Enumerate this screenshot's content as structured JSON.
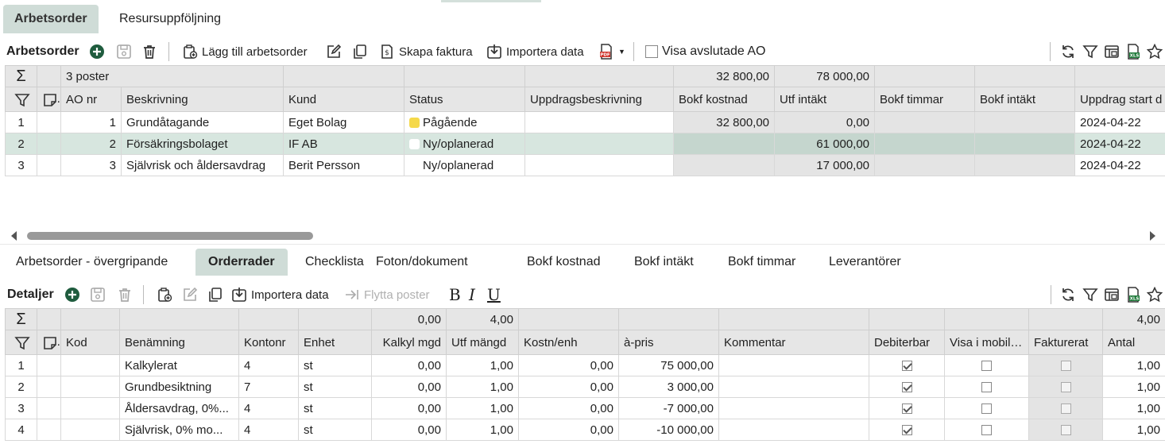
{
  "top_tabs": [
    "Arbetsorder",
    "Resursuppföljning"
  ],
  "toolbar1": {
    "title": "Arbetsorder",
    "add_label": "Lägg till arbetsorder",
    "invoice_label": "Skapa faktura",
    "import_label": "Importera data",
    "show_closed_label": "Visa avslutade AO"
  },
  "grid1": {
    "summary": {
      "count": "3 poster",
      "bokf_kostnad": "32 800,00",
      "utf_intakt": "78 000,00"
    },
    "headers": [
      "AO nr",
      "Beskrivning",
      "Kund",
      "Status",
      "Uppdragsbeskrivning",
      "Bokf kostnad",
      "Utf intäkt",
      "Bokf timmar",
      "Bokf intäkt",
      "Uppdrag start d"
    ],
    "rows": [
      {
        "idx": "1",
        "ao": "1",
        "desc": "Grundåtagande",
        "kund": "Eget Bolag",
        "status": "Pågående",
        "status_color": "#f5d94a",
        "bokf_kostnad": "32 800,00",
        "utf_intakt": "0,00",
        "start": "2024-04-22"
      },
      {
        "idx": "2",
        "ao": "2",
        "desc": "Försäkringsbolaget",
        "kund": "IF AB",
        "status": "Ny/oplanerad",
        "status_color": "#ffffff",
        "bokf_kostnad": "",
        "utf_intakt": "61 000,00",
        "start": "2024-04-22"
      },
      {
        "idx": "3",
        "ao": "3",
        "desc": "Självrisk och åldersavdrag",
        "kund": "Berit Persson",
        "status": "Ny/oplanerad",
        "status_color": "",
        "bokf_kostnad": "",
        "utf_intakt": "17 000,00",
        "start": "2024-04-22"
      }
    ]
  },
  "sub_tabs": [
    "Arbetsorder - övergripande",
    "Orderrader",
    "Checklista",
    "Foton/dokument",
    "Bokf kostnad",
    "Bokf intäkt",
    "Bokf timmar",
    "Leverantörer"
  ],
  "toolbar2": {
    "title": "Detaljer",
    "import_label": "Importera data",
    "move_label": "Flytta poster",
    "bold": "B",
    "italic": "I",
    "underline": "U"
  },
  "grid2": {
    "summary": {
      "kalkyl_mgd": "0,00",
      "utf_mangd": "4,00",
      "antal": "4,00"
    },
    "headers": [
      "Kod",
      "Benämning",
      "Kontonr",
      "Enhet",
      "Kalkyl mgd",
      "Utf mängd",
      "Kostn/enh",
      "à-pris",
      "Kommentar",
      "Debiterbar",
      "Visa i mobilen",
      "Fakturerat",
      "Antal"
    ],
    "rows": [
      {
        "idx": "1",
        "ben": "Kalkylerat",
        "konto": "4",
        "enhet": "st",
        "kalkyl": "0,00",
        "utf": "1,00",
        "kostn": "0,00",
        "pris": "75 000,00",
        "antal": "1,00"
      },
      {
        "idx": "2",
        "ben": "Grundbesiktning",
        "konto": "7",
        "enhet": "st",
        "kalkyl": "0,00",
        "utf": "1,00",
        "kostn": "0,00",
        "pris": "3 000,00",
        "antal": "1,00"
      },
      {
        "idx": "3",
        "ben": "Åldersavdrag, 0%...",
        "konto": "4",
        "enhet": "st",
        "kalkyl": "0,00",
        "utf": "1,00",
        "kostn": "0,00",
        "pris": "-7 000,00",
        "antal": "1,00"
      },
      {
        "idx": "4",
        "ben": "Självrisk, 0% mo...",
        "konto": "4",
        "enhet": "st",
        "kalkyl": "0,00",
        "utf": "1,00",
        "kostn": "0,00",
        "pris": "-10 000,00",
        "antal": "1,00"
      }
    ]
  },
  "colors": {
    "accent": "#1f5c3e",
    "active_tab": "#cfdcd7",
    "selected_row": "#d7e6df"
  }
}
